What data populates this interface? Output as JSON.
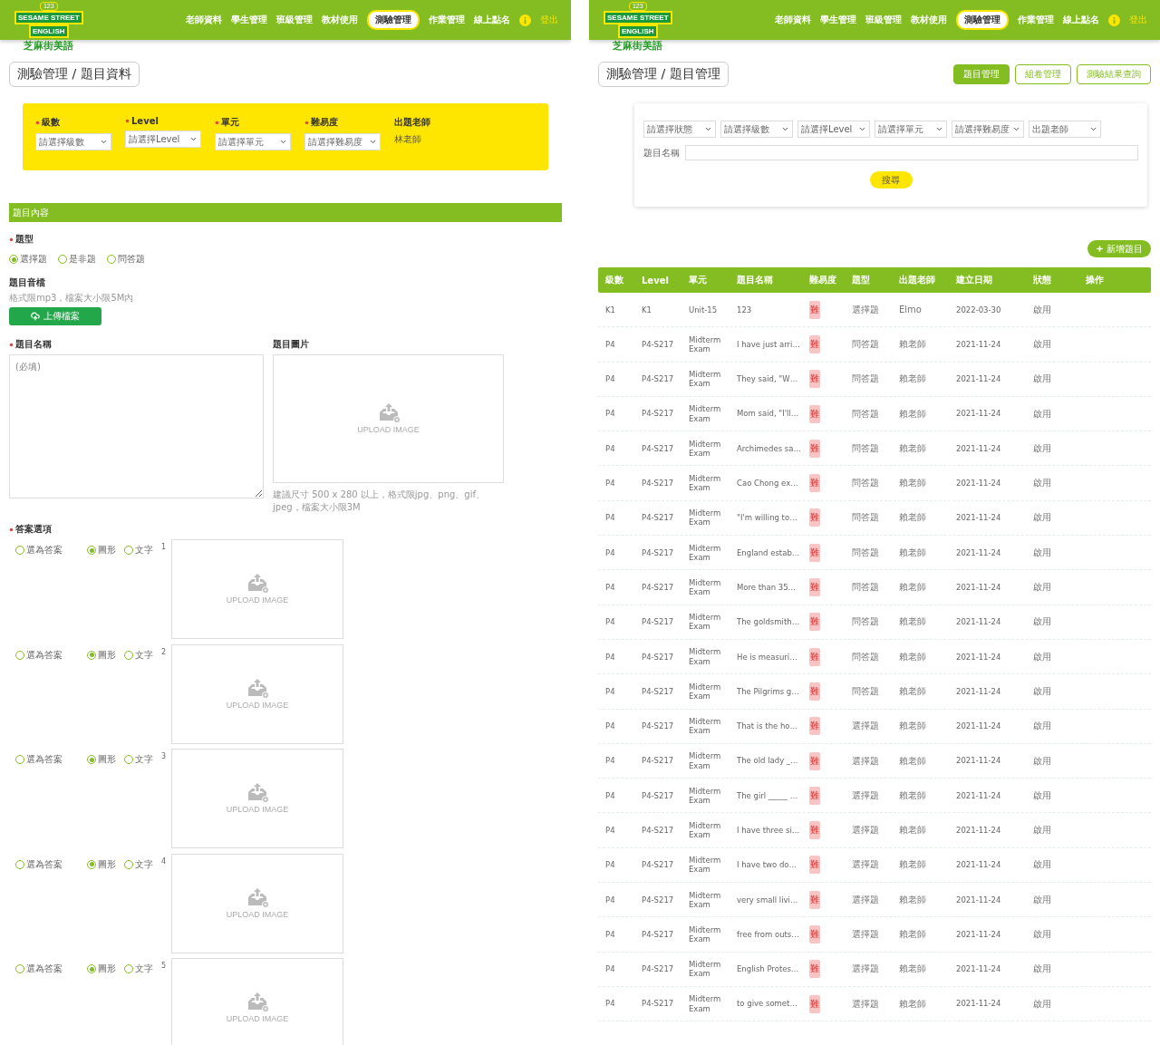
{
  "question_form_screen": {
    "nav": {
      "logo": {
        "badge": "123",
        "line1": "SESAME STREET",
        "line2": "ENGLISH",
        "tagline": "芝麻街美語"
      },
      "items": [
        {
          "label": "老師資料",
          "selected": false
        },
        {
          "label": "學生管理",
          "selected": false
        },
        {
          "label": "班級管理",
          "selected": false
        },
        {
          "label": "教材使用",
          "selected": false
        },
        {
          "label": "測驗管理",
          "selected": true
        },
        {
          "label": "作業管理",
          "selected": false
        },
        {
          "label": "線上點名",
          "selected": false
        }
      ],
      "logout": "登出"
    },
    "breadcrumb": "測驗管理 / 題目資料",
    "filters": [
      {
        "kind": "select",
        "label": "級數",
        "required": true,
        "placeholder": "請選擇級數"
      },
      {
        "kind": "select",
        "label": "Level",
        "required": true,
        "placeholder": "請選擇Level"
      },
      {
        "kind": "select",
        "label": "單元",
        "required": true,
        "placeholder": "請選擇單元"
      },
      {
        "kind": "select",
        "label": "難易度",
        "required": true,
        "placeholder": "請選擇難易度"
      },
      {
        "kind": "text",
        "label": "出題老師",
        "required": false,
        "value": "林老師"
      }
    ],
    "section_title": "題目內容",
    "question_type": {
      "label": "題型",
      "required": true,
      "options": [
        {
          "label": "選擇題",
          "selected": true
        },
        {
          "label": "是非題",
          "selected": false
        },
        {
          "label": "問答題",
          "selected": false
        }
      ]
    },
    "audio": {
      "label": "題目音檔",
      "hint": "格式限mp3，檔案大小限5M內",
      "button": "上傳檔案"
    },
    "question_name": {
      "label": "題目名稱",
      "required": true,
      "placeholder": "(必填)"
    },
    "question_image": {
      "label": "題目圖片",
      "upload_text": "UPLOAD IMAGE",
      "hint": "建議尺寸 500 x 280 以上，格式限jpg、png、gif、jpeg，檔案大小限3M"
    },
    "answers": {
      "label": "答案選項",
      "required": true,
      "options": [
        {
          "correct_label": "選為答案",
          "correct": false,
          "formats": [
            {
              "label": "圖形",
              "selected": true
            },
            {
              "label": "文字",
              "selected": false
            }
          ],
          "number": "1",
          "upload_text": "UPLOAD IMAGE"
        },
        {
          "correct_label": "選為答案",
          "correct": false,
          "formats": [
            {
              "label": "圖形",
              "selected": true
            },
            {
              "label": "文字",
              "selected": false
            }
          ],
          "number": "2",
          "upload_text": "UPLOAD IMAGE"
        },
        {
          "correct_label": "選為答案",
          "correct": false,
          "formats": [
            {
              "label": "圖形",
              "selected": true
            },
            {
              "label": "文字",
              "selected": false
            }
          ],
          "number": "3",
          "upload_text": "UPLOAD IMAGE"
        },
        {
          "correct_label": "選為答案",
          "correct": false,
          "formats": [
            {
              "label": "圖形",
              "selected": true
            },
            {
              "label": "文字",
              "selected": false
            }
          ],
          "number": "4",
          "upload_text": "UPLOAD IMAGE"
        },
        {
          "correct_label": "選為答案",
          "correct": false,
          "formats": [
            {
              "label": "圖形",
              "selected": true
            },
            {
              "label": "文字",
              "selected": false
            }
          ],
          "number": "5",
          "upload_text": "UPLOAD IMAGE"
        }
      ]
    }
  },
  "question_list_screen": {
    "nav": {
      "logo": {
        "badge": "123",
        "line1": "SESAME STREET",
        "line2": "ENGLISH",
        "tagline": "芝麻街美語"
      },
      "items": [
        {
          "label": "老師資料",
          "selected": false
        },
        {
          "label": "學生管理",
          "selected": false
        },
        {
          "label": "班級管理",
          "selected": false
        },
        {
          "label": "教材使用",
          "selected": false
        },
        {
          "label": "測驗管理",
          "selected": true
        },
        {
          "label": "作業管理",
          "selected": false
        },
        {
          "label": "線上點名",
          "selected": false
        }
      ],
      "logout": "登出"
    },
    "breadcrumb": "測驗管理 / 題目管理",
    "tabs": [
      {
        "label": "題目管理",
        "selected": true
      },
      {
        "label": "組卷管理",
        "selected": false
      },
      {
        "label": "測驗結果查詢",
        "selected": false
      }
    ],
    "filters": [
      {
        "placeholder": "請選擇狀態"
      },
      {
        "placeholder": "請選擇級數"
      },
      {
        "placeholder": "請選擇Level"
      },
      {
        "placeholder": "請選擇單元"
      },
      {
        "placeholder": "請選擇難易度"
      },
      {
        "placeholder": "出題老師"
      }
    ],
    "name_filter": {
      "label": "題目名稱"
    },
    "search_button": "搜尋",
    "add_button": "新增題目",
    "table": {
      "columns": [
        "級數",
        "Level",
        "單元",
        "題目名稱",
        "難易度",
        "題型",
        "出題老師",
        "建立日期",
        "狀態",
        "操作"
      ],
      "rows": [
        {
          "grade": "K1",
          "level": "K1",
          "unit": "Unit-15",
          "title": "123",
          "difficulty": "難",
          "type": "選擇題",
          "teacher": "Elmo",
          "created": "2022-03-30",
          "status": "啟用"
        },
        {
          "grade": "P4",
          "level": "P4-S217",
          "unit": "Midterm Exam",
          "title": "I have just arri…",
          "difficulty": "難",
          "type": "問答題",
          "teacher": "賴老師",
          "created": "2021-11-24",
          "status": "啟用"
        },
        {
          "grade": "P4",
          "level": "P4-S217",
          "unit": "Midterm Exam",
          "title": "They said, \"W…",
          "difficulty": "難",
          "type": "問答題",
          "teacher": "賴老師",
          "created": "2021-11-24",
          "status": "啟用"
        },
        {
          "grade": "P4",
          "level": "P4-S217",
          "unit": "Midterm Exam",
          "title": "Mom said, \"I'll…",
          "difficulty": "難",
          "type": "問答題",
          "teacher": "賴老師",
          "created": "2021-11-24",
          "status": "啟用"
        },
        {
          "grade": "P4",
          "level": "P4-S217",
          "unit": "Midterm Exam",
          "title": "Archimedes sa…",
          "difficulty": "難",
          "type": "問答題",
          "teacher": "賴老師",
          "created": "2021-11-24",
          "status": "啟用"
        },
        {
          "grade": "P4",
          "level": "P4-S217",
          "unit": "Midterm Exam",
          "title": "Cao Chong ex…",
          "difficulty": "難",
          "type": "問答題",
          "teacher": "賴老師",
          "created": "2021-11-24",
          "status": "啟用"
        },
        {
          "grade": "P4",
          "level": "P4-S217",
          "unit": "Midterm Exam",
          "title": "\"I'm willing to…",
          "difficulty": "難",
          "type": "問答題",
          "teacher": "賴老師",
          "created": "2021-11-24",
          "status": "啟用"
        },
        {
          "grade": "P4",
          "level": "P4-S217",
          "unit": "Midterm Exam",
          "title": "England estab…",
          "difficulty": "難",
          "type": "問答題",
          "teacher": "賴老師",
          "created": "2021-11-24",
          "status": "啟用"
        },
        {
          "grade": "P4",
          "level": "P4-S217",
          "unit": "Midterm Exam",
          "title": "More than 35…",
          "difficulty": "難",
          "type": "問答題",
          "teacher": "賴老師",
          "created": "2021-11-24",
          "status": "啟用"
        },
        {
          "grade": "P4",
          "level": "P4-S217",
          "unit": "Midterm Exam",
          "title": "The goldsmith…",
          "difficulty": "難",
          "type": "問答題",
          "teacher": "賴老師",
          "created": "2021-11-24",
          "status": "啟用"
        },
        {
          "grade": "P4",
          "level": "P4-S217",
          "unit": "Midterm Exam",
          "title": "He is measuri…",
          "difficulty": "難",
          "type": "問答題",
          "teacher": "賴老師",
          "created": "2021-11-24",
          "status": "啟用"
        },
        {
          "grade": "P4",
          "level": "P4-S217",
          "unit": "Midterm Exam",
          "title": "The Pilgrims g…",
          "difficulty": "難",
          "type": "問答題",
          "teacher": "賴老師",
          "created": "2021-11-24",
          "status": "啟用"
        },
        {
          "grade": "P4",
          "level": "P4-S217",
          "unit": "Midterm Exam",
          "title": "That is the ho…",
          "difficulty": "難",
          "type": "選擇題",
          "teacher": "賴老師",
          "created": "2021-11-24",
          "status": "啟用"
        },
        {
          "grade": "P4",
          "level": "P4-S217",
          "unit": "Midterm Exam",
          "title": "The old lady _…",
          "difficulty": "難",
          "type": "選擇題",
          "teacher": "賴老師",
          "created": "2021-11-24",
          "status": "啟用"
        },
        {
          "grade": "P4",
          "level": "P4-S217",
          "unit": "Midterm Exam",
          "title": "The girl _____ …",
          "difficulty": "難",
          "type": "選擇題",
          "teacher": "賴老師",
          "created": "2021-11-24",
          "status": "啟用"
        },
        {
          "grade": "P4",
          "level": "P4-S217",
          "unit": "Midterm Exam",
          "title": "I have three si…",
          "difficulty": "難",
          "type": "選擇題",
          "teacher": "賴老師",
          "created": "2021-11-24",
          "status": "啟用"
        },
        {
          "grade": "P4",
          "level": "P4-S217",
          "unit": "Midterm Exam",
          "title": "I have two do…",
          "difficulty": "難",
          "type": "選擇題",
          "teacher": "賴老師",
          "created": "2021-11-24",
          "status": "啟用"
        },
        {
          "grade": "P4",
          "level": "P4-S217",
          "unit": "Midterm Exam",
          "title": "very small livi…",
          "difficulty": "難",
          "type": "選擇題",
          "teacher": "賴老師",
          "created": "2021-11-24",
          "status": "啟用"
        },
        {
          "grade": "P4",
          "level": "P4-S217",
          "unit": "Midterm Exam",
          "title": "free from outs…",
          "difficulty": "難",
          "type": "選擇題",
          "teacher": "賴老師",
          "created": "2021-11-24",
          "status": "啟用"
        },
        {
          "grade": "P4",
          "level": "P4-S217",
          "unit": "Midterm Exam",
          "title": "English Protes…",
          "difficulty": "難",
          "type": "選擇題",
          "teacher": "賴老師",
          "created": "2021-11-24",
          "status": "啟用"
        },
        {
          "grade": "P4",
          "level": "P4-S217",
          "unit": "Midterm Exam",
          "title": "to give somet…",
          "difficulty": "難",
          "type": "選擇題",
          "teacher": "賴老師",
          "created": "2021-11-24",
          "status": "啟用"
        }
      ]
    }
  }
}
